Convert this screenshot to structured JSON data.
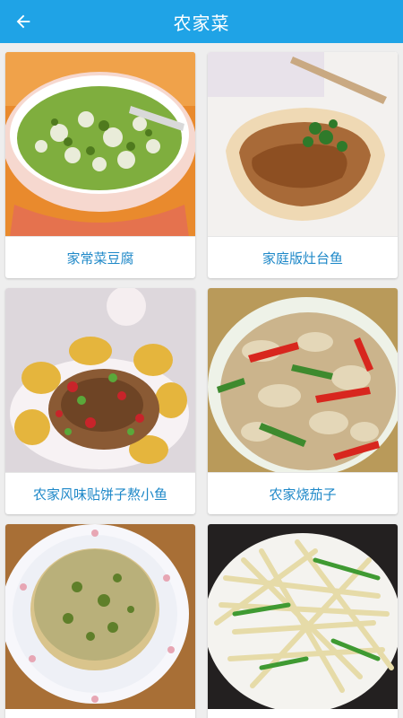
{
  "header": {
    "title": "农家菜",
    "back_icon": "arrow-left-icon",
    "bg_color": "#1fa3e6"
  },
  "recipes": [
    {
      "name": "家常菜豆腐",
      "image": "tofu-soup-photo"
    },
    {
      "name": "家庭版灶台鱼",
      "image": "braised-fish-photo"
    },
    {
      "name": "农家风味贴饼子熬小鱼",
      "image": "fish-with-cornbread-photo"
    },
    {
      "name": "农家烧茄子",
      "image": "braised-eggplant-photo"
    },
    {
      "name": "",
      "image": "scallion-pancake-photo"
    },
    {
      "name": "",
      "image": "stir-fried-potato-strips-photo"
    }
  ],
  "caption_color": "#1e88c8"
}
